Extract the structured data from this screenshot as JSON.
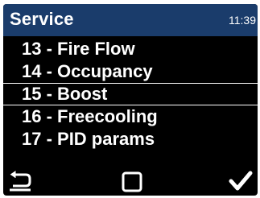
{
  "header": {
    "title": "Service",
    "time": "11:39"
  },
  "menu": {
    "items": [
      {
        "label": "13 - Fire Flow",
        "selected": false
      },
      {
        "label": "14 - Occupancy",
        "selected": false
      },
      {
        "label": "15 - Boost",
        "selected": true
      },
      {
        "label": "16 - Freecooling",
        "selected": false
      },
      {
        "label": "17 - PID params",
        "selected": false
      }
    ]
  },
  "softkeys": {
    "back_icon": "back-arrow-icon",
    "home_icon": "square-icon",
    "ok_icon": "checkmark-icon"
  },
  "colors": {
    "titlebar": "#1a3c6b",
    "background": "#000000",
    "text": "#ffffff"
  }
}
